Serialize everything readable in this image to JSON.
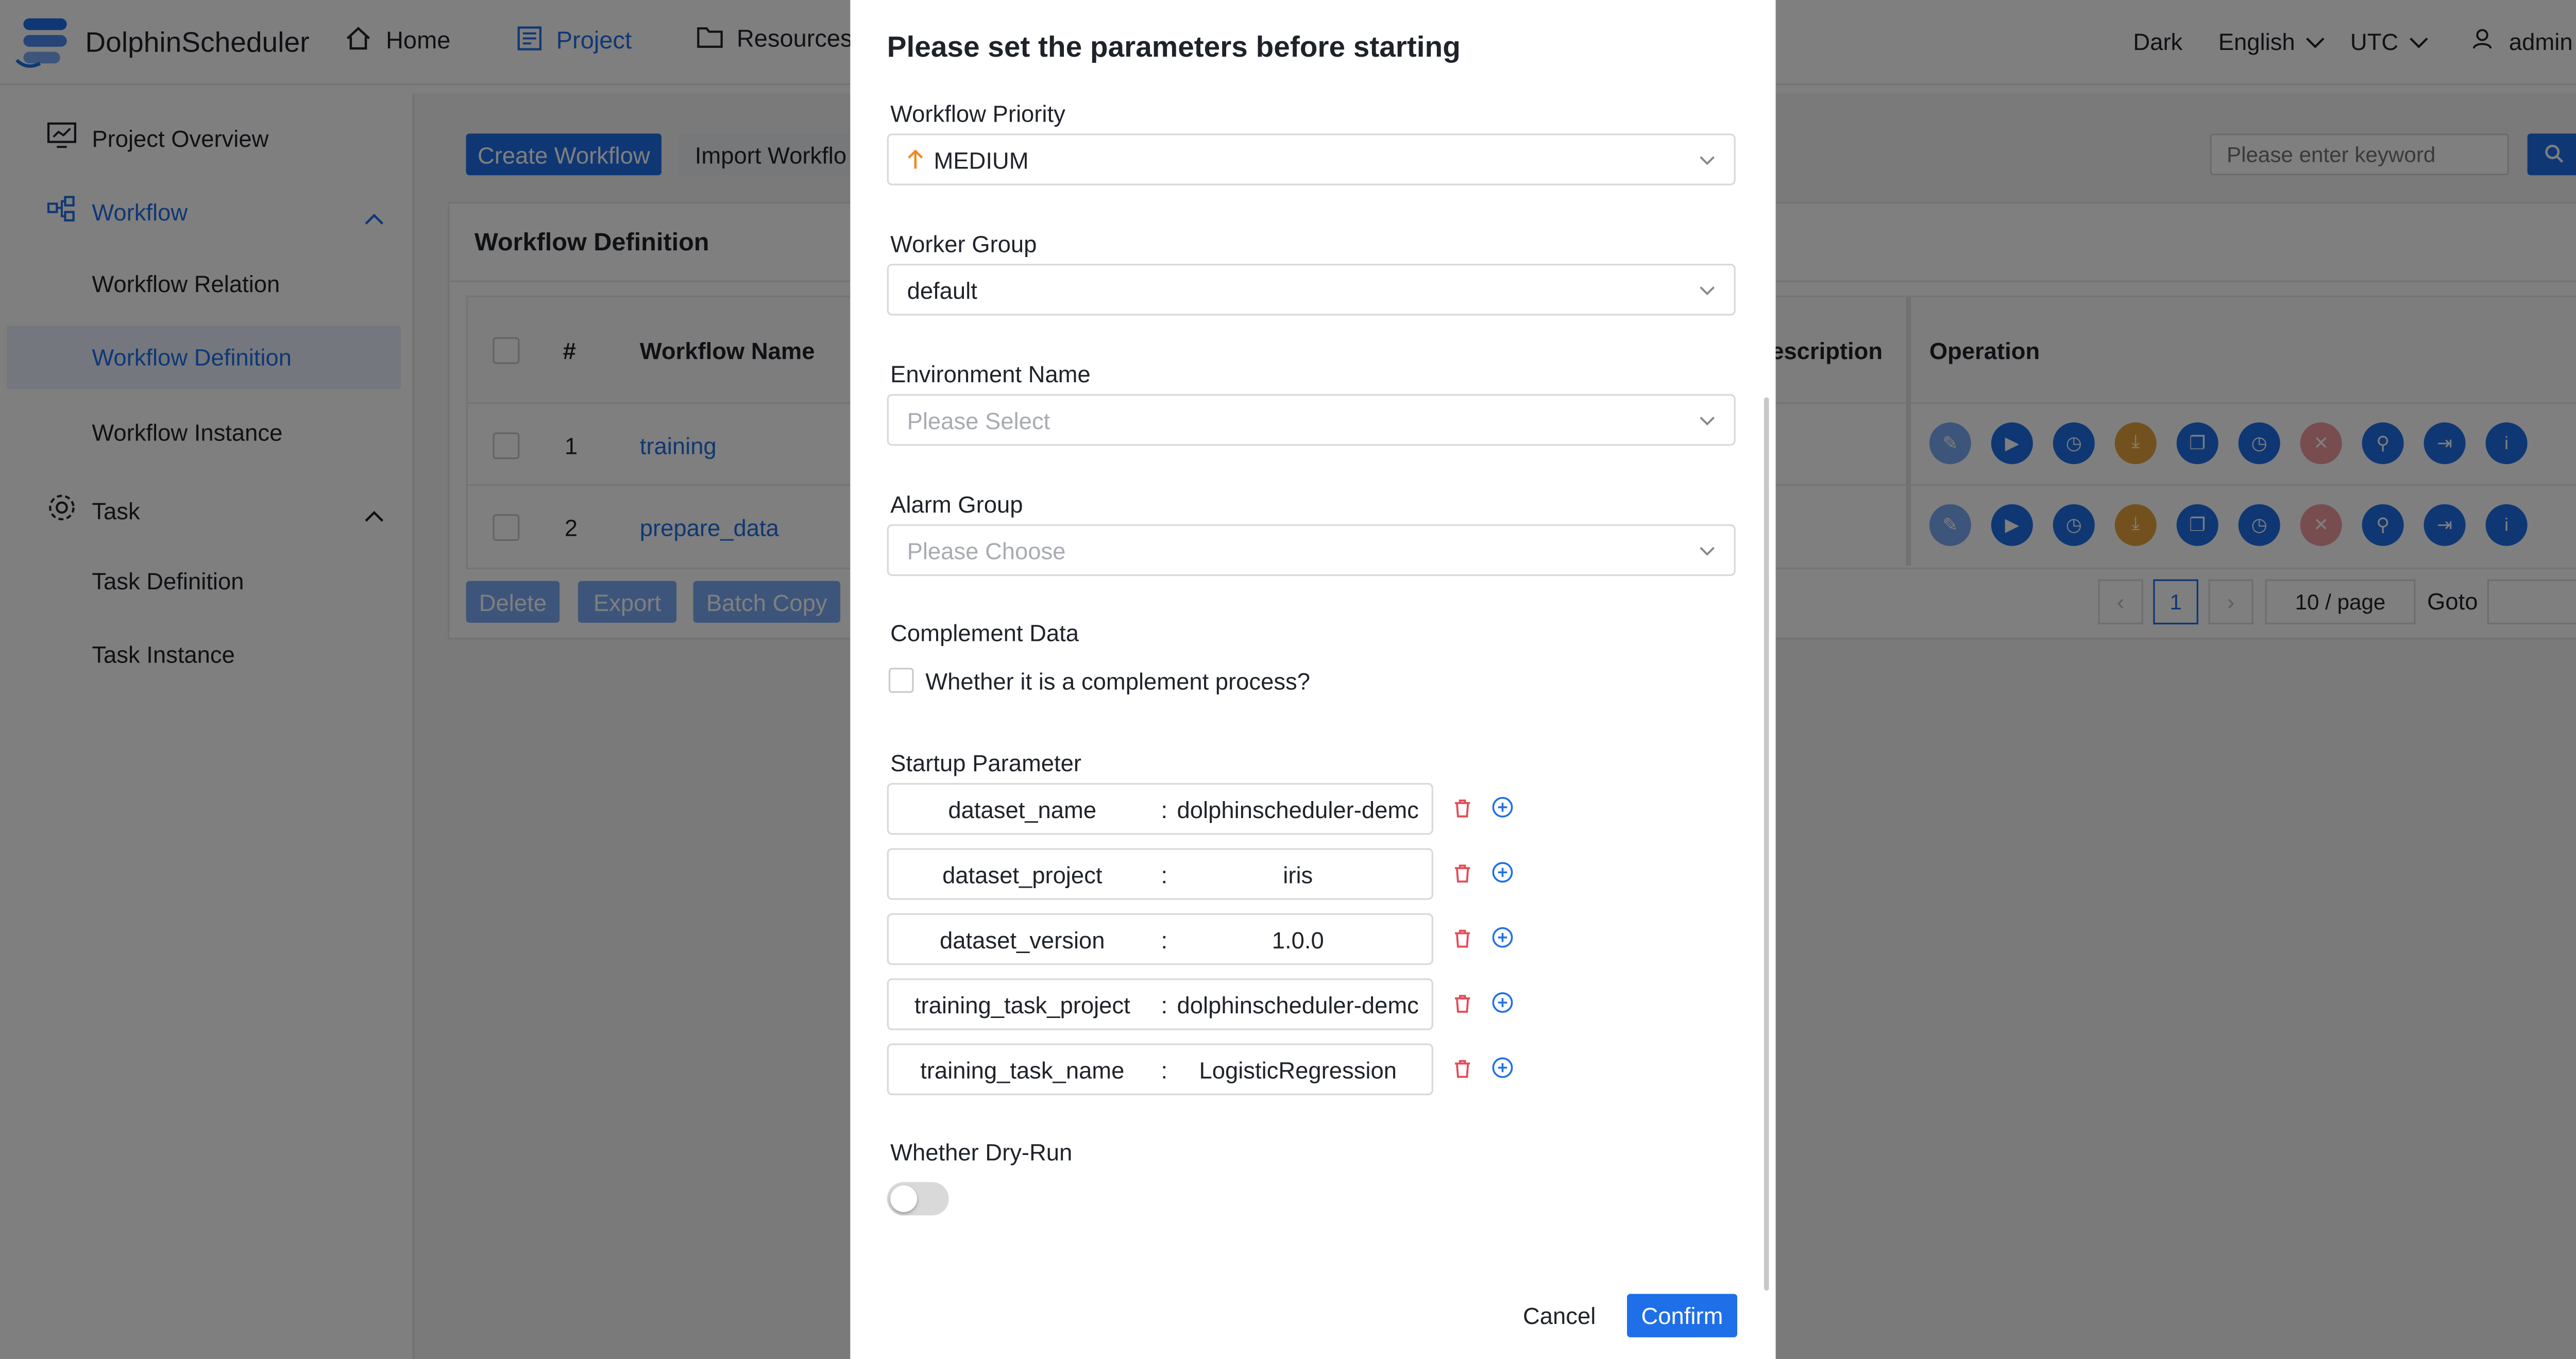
{
  "header": {
    "app_name": "DolphinScheduler",
    "nav": [
      {
        "label": "Home",
        "icon": "home-icon"
      },
      {
        "label": "Project",
        "icon": "project-icon"
      },
      {
        "label": "Resources",
        "icon": "folder-icon"
      }
    ],
    "theme": "Dark",
    "language": "English",
    "timezone": "UTC",
    "user": "admin"
  },
  "sidebar": {
    "items": [
      {
        "label": "Project Overview"
      },
      {
        "label": "Workflow"
      },
      {
        "label": "Workflow Relation"
      },
      {
        "label": "Workflow Definition"
      },
      {
        "label": "Workflow Instance"
      },
      {
        "label": "Task"
      },
      {
        "label": "Task Definition"
      },
      {
        "label": "Task Instance"
      }
    ]
  },
  "main": {
    "create_button": "Create Workflow",
    "import_button": "Import Workflo",
    "search_placeholder": "Please enter keyword",
    "card_title": "Workflow Definition",
    "columns": {
      "num": "#",
      "name": "Workflow Name",
      "description": "Description",
      "operation": "Operation"
    },
    "rows": [
      {
        "num": "1",
        "name": "training"
      },
      {
        "num": "2",
        "name": "prepare_data"
      }
    ],
    "bottom_buttons": {
      "delete": "Delete",
      "export": "Export",
      "batch_copy": "Batch Copy"
    },
    "pagination": {
      "current": "1",
      "page_size": "10 / page",
      "goto": "Goto"
    }
  },
  "modal": {
    "title": "Please set the parameters before starting",
    "priority": {
      "label": "Workflow Priority",
      "value": "MEDIUM"
    },
    "worker_group": {
      "label": "Worker Group",
      "value": "default"
    },
    "environment": {
      "label": "Environment Name",
      "placeholder": "Please Select"
    },
    "alarm_group": {
      "label": "Alarm Group",
      "placeholder": "Please Choose"
    },
    "complement": {
      "label": "Complement Data",
      "checkbox": "Whether it is a complement process?"
    },
    "startup": {
      "label": "Startup Parameter",
      "params": [
        {
          "key": "dataset_name",
          "value": "dolphinscheduler-demc"
        },
        {
          "key": "dataset_project",
          "value": "iris"
        },
        {
          "key": "dataset_version",
          "value": "1.0.0"
        },
        {
          "key": "training_task_project",
          "value": "dolphinscheduler-demc"
        },
        {
          "key": "training_task_name",
          "value": "LogisticRegression"
        }
      ]
    },
    "dry_run": {
      "label": "Whether Dry-Run",
      "enabled": false
    },
    "cancel": "Cancel",
    "confirm": "Confirm"
  },
  "colors": {
    "primary": "#1f6fe8",
    "danger": "#e34d59",
    "warning": "#e6a23c",
    "priority_arrow": "#f08a24"
  }
}
